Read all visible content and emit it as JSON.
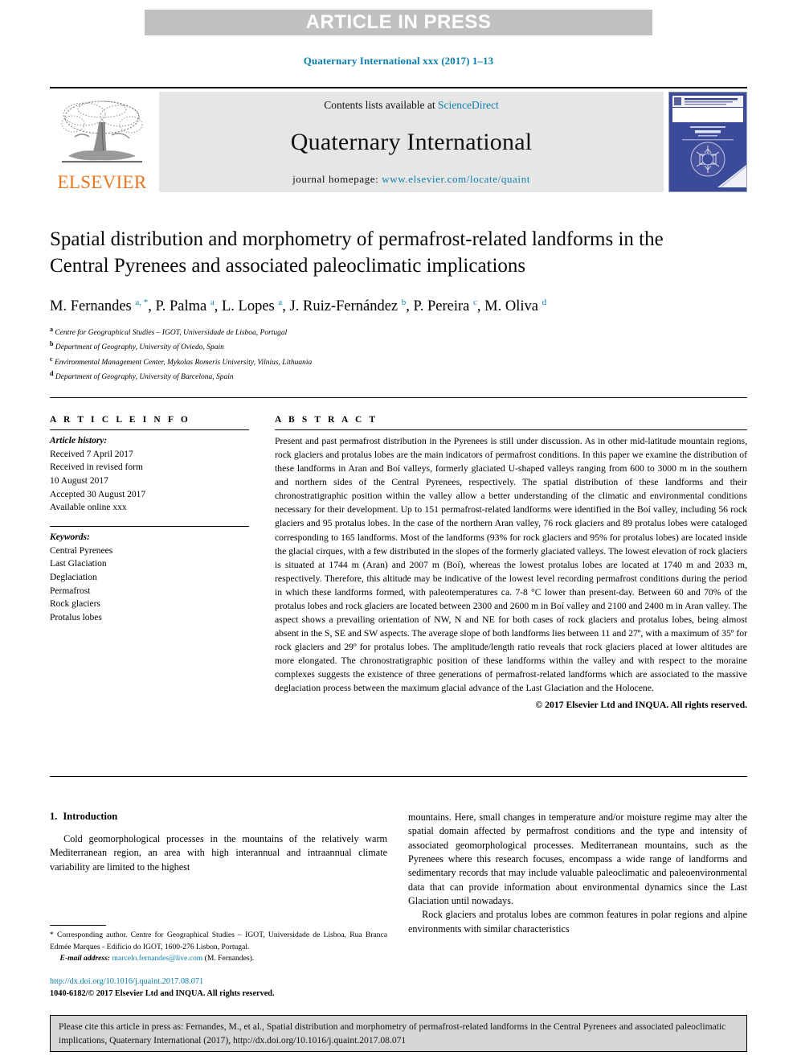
{
  "banner": {
    "label": "ARTICLE IN PRESS"
  },
  "running_head": {
    "text": "Quaternary International xxx (2017) 1–13"
  },
  "masthead": {
    "publisher_logo_text": "ELSEVIER",
    "contents_prefix": "Contents lists available at ",
    "contents_link": "ScienceDirect",
    "journal_title": "Quaternary International",
    "homepage_label": "journal homepage: ",
    "homepage_url": "www.elsevier.com/locate/quaint",
    "cover_journal_name": "QUATERNARY INTERNATIONAL",
    "cover_subtitle": "The Journal of the International Union for Quaternary Research"
  },
  "article": {
    "title": "Spatial distribution and morphometry of permafrost-related landforms in the Central Pyrenees and associated paleoclimatic implications",
    "authors_html": "M. Fernandes <sup>a, *</sup>, P. Palma <sup>a</sup>, L. Lopes <sup>a</sup>, J. Ruiz-Fernández <sup>b</sup>, P. Pereira <sup>c</sup>, M. Oliva <sup>d</sup>",
    "affiliations": [
      {
        "marker": "a",
        "text": "Centre for Geographical Studies – IGOT, Universidade de Lisboa, Portugal"
      },
      {
        "marker": "b",
        "text": "Department of Geography, University of Oviedo, Spain"
      },
      {
        "marker": "c",
        "text": "Environmental Management Center, Mykolas Romeris University, Vilnius, Lithuania"
      },
      {
        "marker": "d",
        "text": "Department of Geography, University of Barcelona, Spain"
      }
    ]
  },
  "article_info": {
    "heading": "A R T I C L E  I N F O",
    "history_title": "Article history:",
    "history_lines": [
      "Received 7 April 2017",
      "Received in revised form",
      "10 August 2017",
      "Accepted 30 August 2017",
      "Available online xxx"
    ],
    "keywords_title": "Keywords:",
    "keywords": [
      "Central Pyrenees",
      "Last Glaciation",
      "Deglaciation",
      "Permafrost",
      "Rock glaciers",
      "Protalus lobes"
    ]
  },
  "abstract": {
    "heading": "A B S T R A C T",
    "body": "Present and past permafrost distribution in the Pyrenees is still under discussion. As in other mid-latitude mountain regions, rock glaciers and protalus lobes are the main indicators of permafrost conditions. In this paper we examine the distribution of these landforms in Aran and Boí valleys, formerly glaciated U-shaped valleys ranging from 600 to 3000 m in the southern and northern sides of the Central Pyrenees, respectively. The spatial distribution of these landforms and their chronostratigraphic position within the valley allow a better understanding of the climatic and environmental conditions necessary for their development. Up to 151 permafrost-related landforms were identified in the Boí valley, including 56 rock glaciers and 95 protalus lobes. In the case of the northern Aran valley, 76 rock glaciers and 89 protalus lobes were cataloged corresponding to 165 landforms. Most of the landforms (93% for rock glaciers and 95% for protalus lobes) are located inside the glacial cirques, with a few distributed in the slopes of the formerly glaciated valleys. The lowest elevation of rock glaciers is situated at 1744 m (Aran) and 2007 m (Boí), whereas the lowest protalus lobes are located at 1740 m and 2033 m, respectively. Therefore, this altitude may be indicative of the lowest level recording permafrost conditions during the period in which these landforms formed, with paleotemperatures ca. 7-8 °C lower than present-day. Between 60 and 70% of the protalus lobes and rock glaciers are located between 2300 and 2600 m in Boí valley and 2100 and 2400 m in Aran valley. The aspect shows a prevailing orientation of NW, N and NE for both cases of rock glaciers and protalus lobes, being almost absent in the S, SE and SW aspects. The average slope of both landforms lies between 11 and 27º, with a maximum of 35º for rock glaciers and 29º for protalus lobes. The amplitude/length ratio reveals that rock glaciers placed at lower altitudes are more elongated. The chronostratigraphic position of these landforms within the valley and with respect to the moraine complexes suggests the existence of three generations of permafrost-related landforms which are associated to the massive deglaciation process between the maximum glacial advance of the Last Glaciation and the Holocene.",
    "copyright": "© 2017 Elsevier Ltd and INQUA. All rights reserved."
  },
  "introduction": {
    "number": "1.",
    "heading": "Introduction",
    "left_paragraph": "Cold geomorphological processes in the mountains of the relatively warm Mediterranean region, an area with high interannual and intraannual climate variability are limited to the highest",
    "right_paragraph_1": "mountains. Here, small changes in temperature and/or moisture regime may alter the spatial domain affected by permafrost conditions and the type and intensity of associated geomorphological processes. Mediterranean mountains, such as the Pyrenees where this research focuses, encompass a wide range of landforms and sedimentary records that may include valuable paleoclimatic and paleoenvironmental data that can provide information about environmental dynamics since the Last Glaciation until nowadays.",
    "right_paragraph_2": "Rock glaciers and protalus lobes are common features in polar regions and alpine environments with similar characteristics"
  },
  "footnote": {
    "corresponding": "* Corresponding author. Centre for Geographical Studies – IGOT, Universidade de Lisboa, Rua Branca Edmée Marques - Edifício do IGOT, 1600-276 Lisbon, Portugal.",
    "email_label": "E-mail address:",
    "email": "marcelo.fernandes@live.com",
    "email_suffix": "(M. Fernandes)."
  },
  "doi_block": {
    "doi_url": "http://dx.doi.org/10.1016/j.quaint.2017.08.071",
    "issn_line": "1040-6182/© 2017 Elsevier Ltd and INQUA. All rights reserved."
  },
  "cite_box": {
    "text": "Please cite this article in press as: Fernandes, M., et al., Spatial distribution and morphometry of permafrost-related landforms in the Central Pyrenees and associated paleoclimatic implications, Quaternary International (2017), http://dx.doi.org/10.1016/j.quaint.2017.08.071"
  },
  "colors": {
    "link_blue": "#0b7fab",
    "banner_gray": "#c0c0c2",
    "masthead_gray": "#e6e6e6",
    "elsevier_orange": "#e87722",
    "cover_blue": "#3c4a9a",
    "cite_box_gray": "#d6d6d6"
  }
}
